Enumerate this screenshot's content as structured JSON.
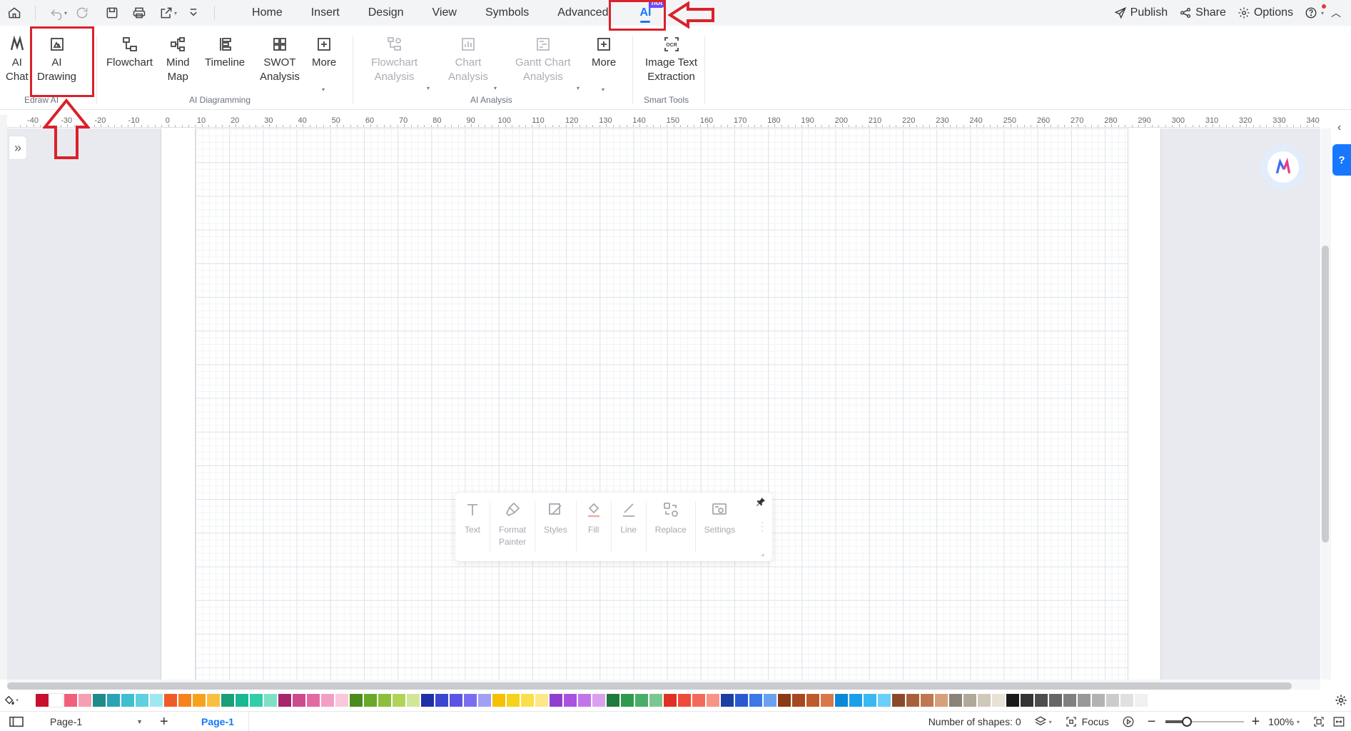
{
  "menubar": {
    "quick_access": [
      "home-icon",
      "undo-icon",
      "redo-icon",
      "save-icon",
      "print-icon",
      "export-icon",
      "more-icon"
    ],
    "menus": [
      "Home",
      "Insert",
      "Design",
      "View",
      "Symbols",
      "Advanced",
      "AI"
    ],
    "active_menu": "AI",
    "hot_badge": "hot",
    "right": {
      "publish": "Publish",
      "share": "Share",
      "options": "Options"
    }
  },
  "ribbon": {
    "groups": [
      {
        "label": "Edraw AI",
        "buttons": [
          {
            "label": "AI\nChat"
          },
          {
            "label": "AI\nDrawing"
          }
        ]
      },
      {
        "label": "AI Diagramming",
        "buttons": [
          {
            "label": "Flowchart"
          },
          {
            "label": "Mind\nMap"
          },
          {
            "label": "Timeline"
          },
          {
            "label": "SWOT\nAnalysis"
          },
          {
            "label": "More"
          }
        ]
      },
      {
        "label": "AI Analysis",
        "buttons": [
          {
            "label": "Flowchart\nAnalysis"
          },
          {
            "label": "Chart\nAnalysis"
          },
          {
            "label": "Gantt Chart\nAnalysis"
          },
          {
            "label": "More"
          }
        ]
      },
      {
        "label": "Smart Tools",
        "buttons": [
          {
            "label": "Image Text\nExtraction"
          }
        ]
      }
    ]
  },
  "ruler": {
    "ticks": [
      "-40",
      "-30",
      "-20",
      "-10",
      "0",
      "10",
      "20",
      "30",
      "40",
      "50",
      "60",
      "70",
      "80",
      "90",
      "100",
      "110",
      "120",
      "130",
      "140",
      "150",
      "160",
      "170",
      "180",
      "190",
      "200",
      "210",
      "220",
      "230",
      "240",
      "250",
      "260",
      "270",
      "280",
      "290",
      "300",
      "310",
      "320",
      "330",
      "340"
    ]
  },
  "float_toolbar": {
    "items": [
      {
        "label": "Text",
        "icon": "text-icon"
      },
      {
        "label": "Format\nPainter",
        "icon": "format-painter-icon"
      },
      {
        "label": "Styles",
        "icon": "styles-icon"
      },
      {
        "label": "Fill",
        "icon": "fill-icon"
      },
      {
        "label": "Line",
        "icon": "line-icon"
      },
      {
        "label": "Replace",
        "icon": "replace-icon"
      },
      {
        "label": "Settings",
        "icon": "settings-icon"
      }
    ]
  },
  "colors": {
    "accent": "#1677ff",
    "annotation": "#d9222a",
    "palette": [
      "#c8102e",
      "#ffffff",
      "#f0607a",
      "#f4a0b0",
      "#1f8a8a",
      "#2aa3b8",
      "#3cc0d0",
      "#5fd0e0",
      "#a0e8f0",
      "#f05a28",
      "#f7821f",
      "#f7a21f",
      "#fbbf40",
      "#1a9e77",
      "#18b894",
      "#2ecfa8",
      "#7fe0c8",
      "#a8256e",
      "#cc4b8c",
      "#e26aa4",
      "#f29fc5",
      "#f8c8dc",
      "#4a8c1c",
      "#6aa82a",
      "#8cbf3a",
      "#b0d45a",
      "#d2e69a",
      "#1f2fa8",
      "#3a48d0",
      "#5a55e6",
      "#7a6ef0",
      "#a0a0f5",
      "#f5c000",
      "#f7d21a",
      "#fade4a",
      "#fce888",
      "#8e3fd0",
      "#aa52e0",
      "#c474ea",
      "#d9a0f2",
      "#1e7a3a",
      "#2e9a4e",
      "#4aae68",
      "#7ac890",
      "#e03024",
      "#f04a3a",
      "#f46a5a",
      "#f79486",
      "#1a3fa0",
      "#2a5ad0",
      "#3a78e8",
      "#6aa0f0",
      "#8a3a14",
      "#a84820",
      "#c05a2a",
      "#d87848",
      "#0a88d8",
      "#1aa0ea",
      "#3ab8f2",
      "#6ad0f8",
      "#8a4a2a",
      "#a8603a",
      "#c07850",
      "#d8a078",
      "#8a8478",
      "#b0a898",
      "#d0c8b8",
      "#e8e2d6",
      "#1a1a1a",
      "#333333",
      "#4d4d4d",
      "#666666",
      "#808080",
      "#999999",
      "#b3b3b3",
      "#cccccc",
      "#e0e0e0",
      "#f0f0f0"
    ]
  },
  "statusbar": {
    "page_select": "Page-1",
    "page_tab": "Page-1",
    "shape_count": "Number of shapes: 0",
    "focus": "Focus",
    "zoom": "100%",
    "zoom_fraction": 0.27
  }
}
